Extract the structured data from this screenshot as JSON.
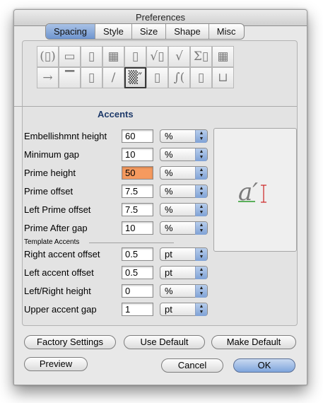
{
  "window": {
    "title": "Preferences"
  },
  "tabs": [
    {
      "label": "Spacing",
      "selected": true
    },
    {
      "label": "Style",
      "selected": false
    },
    {
      "label": "Size",
      "selected": false
    },
    {
      "label": "Shape",
      "selected": false
    },
    {
      "label": "Misc",
      "selected": false
    }
  ],
  "icon_toolbar": {
    "row1": [
      {
        "name": "parentheses-icon",
        "glyph": "(▯)"
      },
      {
        "name": "fraction-icon",
        "glyph": "▭"
      },
      {
        "name": "stack-icon",
        "glyph": "▯"
      },
      {
        "name": "subscript-superscript-icon",
        "glyph": "▦"
      },
      {
        "name": "limits-icon",
        "glyph": "▯"
      },
      {
        "name": "sqrt-box-icon",
        "glyph": "√▯"
      },
      {
        "name": "radical-icon",
        "glyph": "√"
      },
      {
        "name": "summation-icon",
        "glyph": "Σ▯"
      },
      {
        "name": "matrix-icon",
        "glyph": "▦"
      }
    ],
    "row2": [
      {
        "name": "arrow-over-icon",
        "glyph": "→"
      },
      {
        "name": "overbar-icon",
        "glyph": "▔"
      },
      {
        "name": "boxed-icon",
        "glyph": "▯"
      },
      {
        "name": "slash-icon",
        "glyph": "/"
      },
      {
        "name": "accent-prime-icon",
        "glyph": "▒″",
        "selected": true
      },
      {
        "name": "script-icon",
        "glyph": "▯"
      },
      {
        "name": "integral-icon",
        "glyph": "∫("
      },
      {
        "name": "dotted-box-icon",
        "glyph": "▯"
      },
      {
        "name": "underbracket-icon",
        "glyph": "⊔"
      }
    ]
  },
  "section_title": "Accents",
  "fields": [
    {
      "label": "Embellishmnt height",
      "value": "60",
      "unit": "%"
    },
    {
      "label": "Minimum gap",
      "value": "10",
      "unit": "%"
    },
    {
      "label": "Prime height",
      "value": "50",
      "unit": "%",
      "highlighted": true
    },
    {
      "label": "Prime offset",
      "value": "7.5",
      "unit": "%"
    },
    {
      "label": "Left Prime offset",
      "value": "7.5",
      "unit": "%"
    },
    {
      "label": "Prime After gap",
      "value": "10",
      "unit": "%"
    }
  ],
  "template_accents_heading": "Template Accents",
  "template_fields": [
    {
      "label": "Right accent offset",
      "value": "0.5",
      "unit": "pt"
    },
    {
      "label": "Left accent offset",
      "value": "0.5",
      "unit": "pt"
    },
    {
      "label": "Left/Right height",
      "value": "0",
      "unit": "%"
    },
    {
      "label": "Upper accent gap",
      "value": "1",
      "unit": "pt"
    }
  ],
  "preview": {
    "glyph": "a′"
  },
  "buttons": {
    "factory_settings": "Factory Settings",
    "use_default": "Use Default",
    "make_default": "Make Default",
    "preview": "Preview",
    "cancel": "Cancel",
    "ok": "OK"
  },
  "colors": {
    "highlight": "#f59a5f",
    "section_title": "#1e3a6a",
    "tab_selected": "#7fa2d6",
    "preview_marker": "#cc2222",
    "preview_baseline": "#2a9a2a"
  }
}
